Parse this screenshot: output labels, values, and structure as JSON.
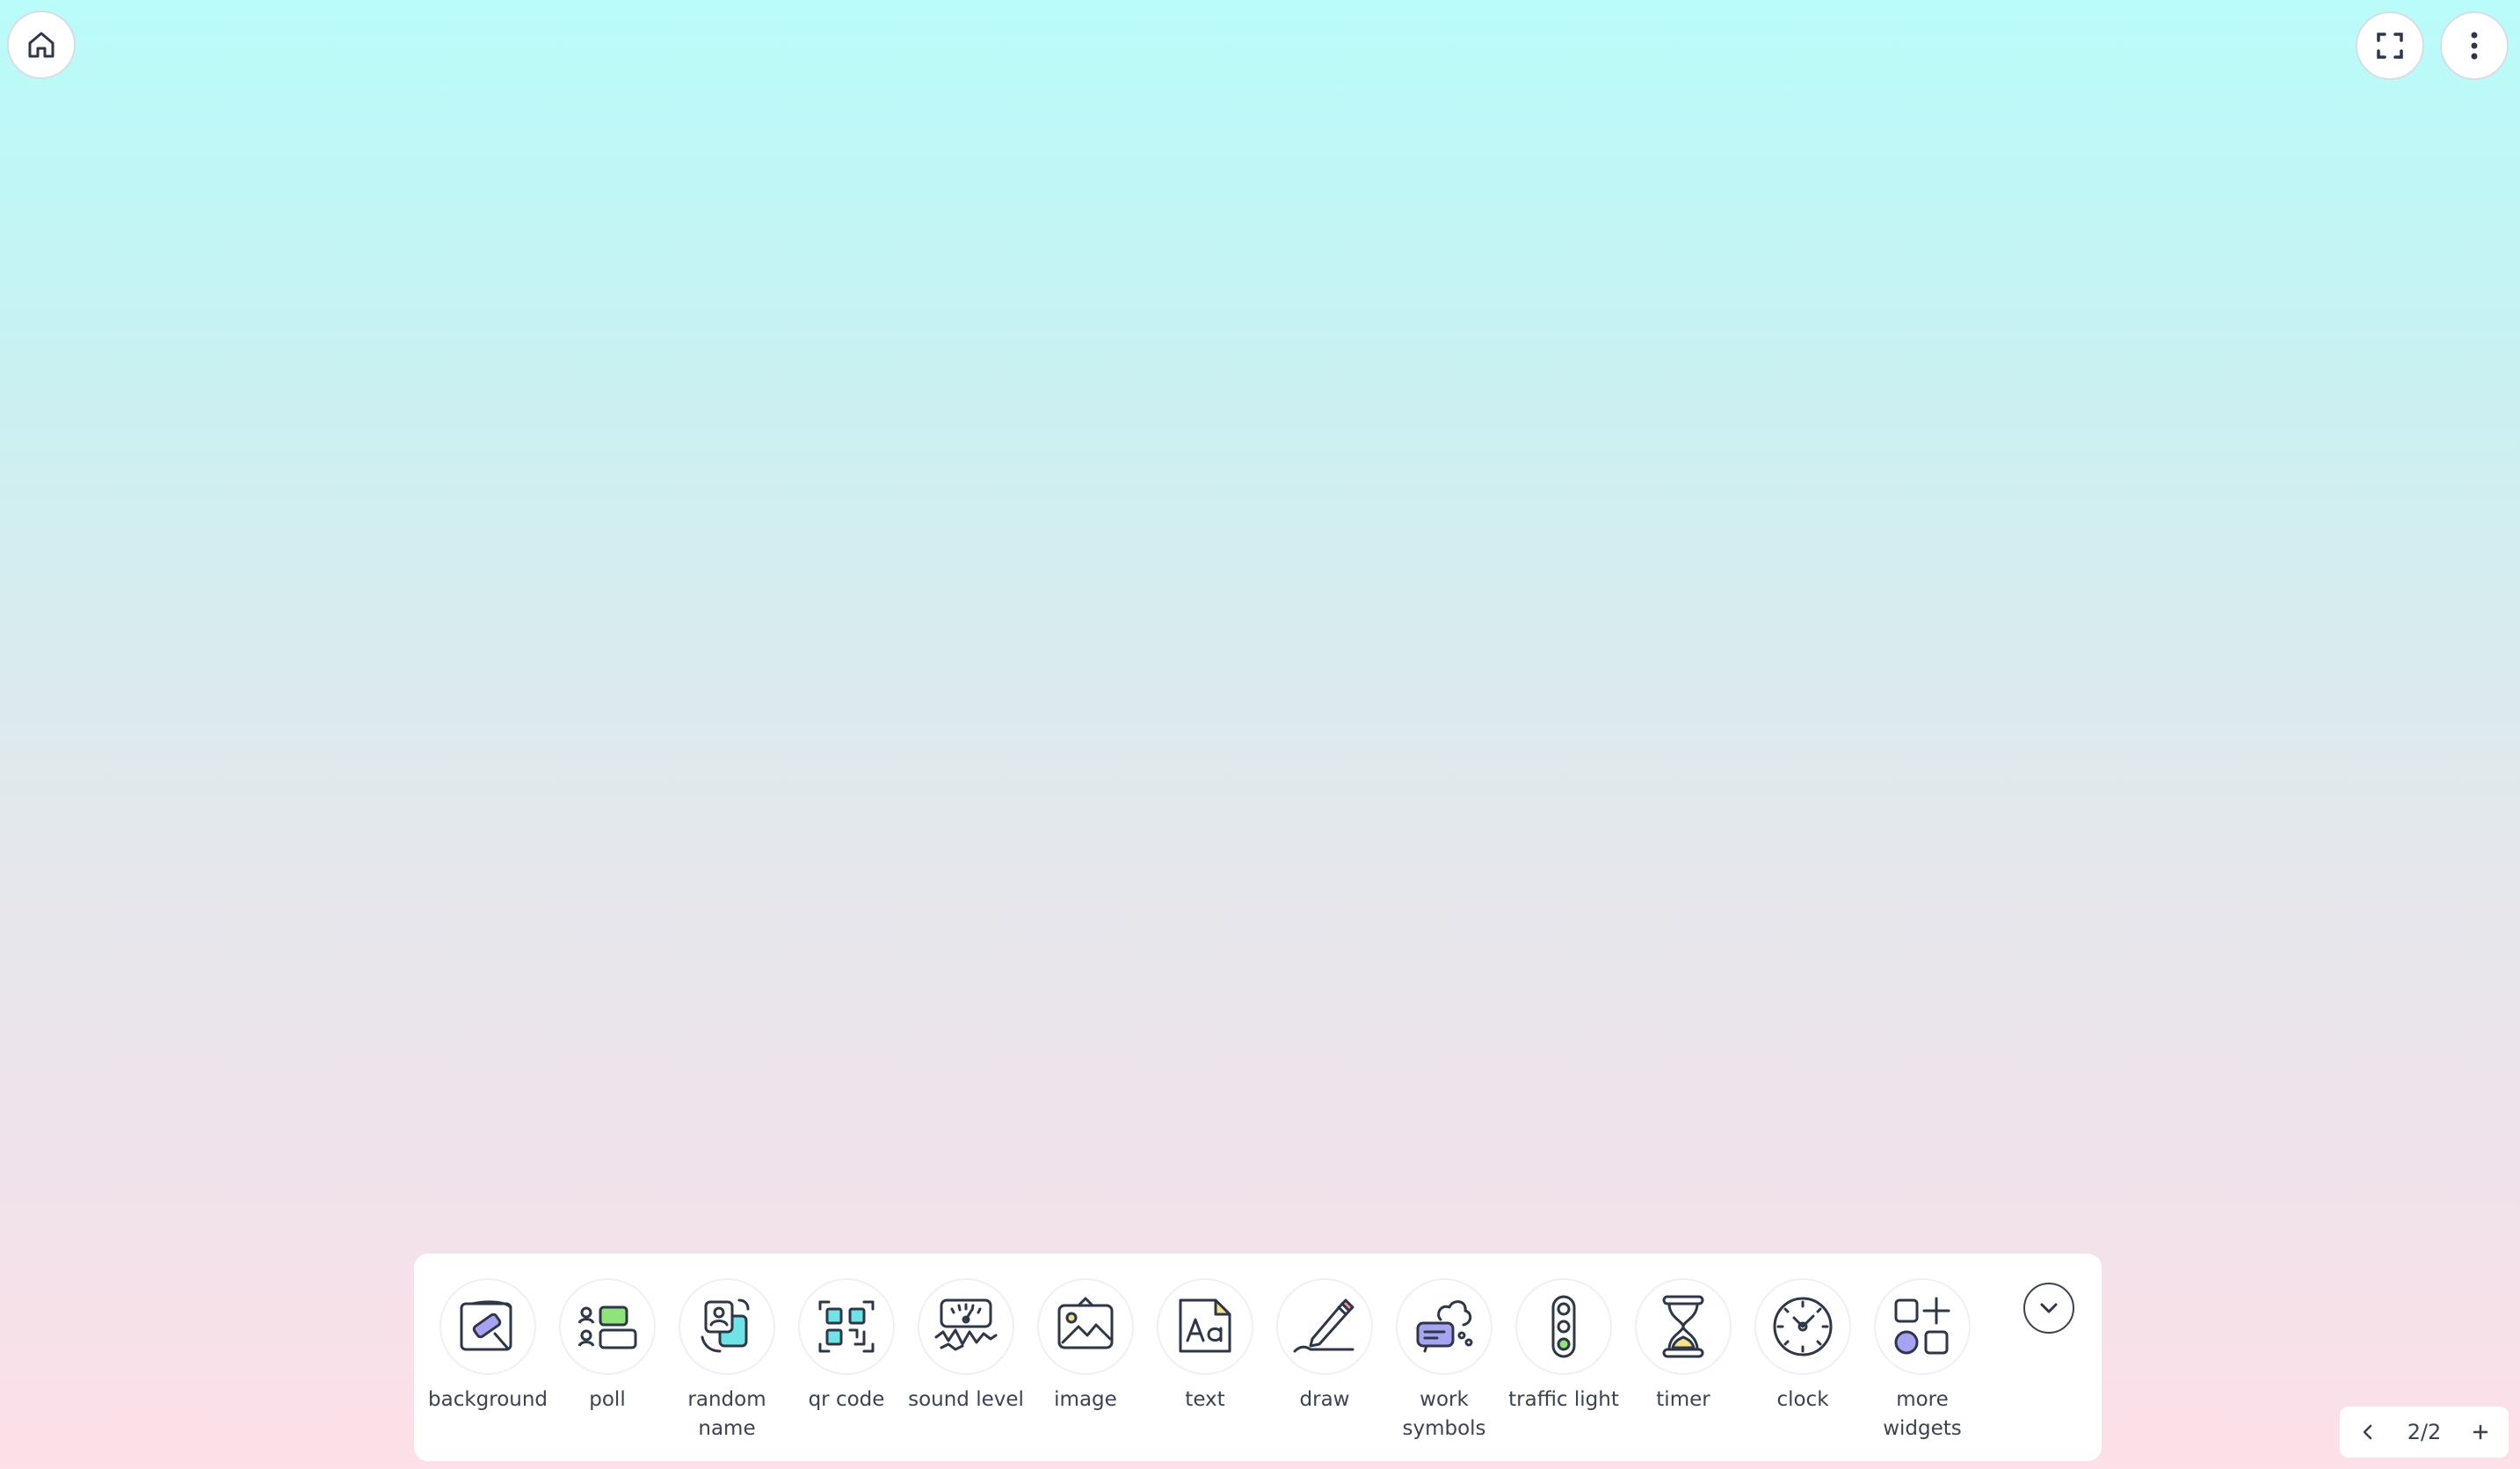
{
  "top_controls": {
    "home_icon": "home-icon",
    "fullscreen_icon": "fullscreen-icon",
    "menu_icon": "vertical-dots-icon"
  },
  "toolbar": {
    "tools": [
      {
        "label": "background",
        "icon": "paint-roller-icon"
      },
      {
        "label": "poll",
        "icon": "poll-icon"
      },
      {
        "label": "random name",
        "icon": "random-name-icon"
      },
      {
        "label": "qr code",
        "icon": "qr-code-icon"
      },
      {
        "label": "sound level",
        "icon": "sound-level-icon"
      },
      {
        "label": "image",
        "icon": "image-icon"
      },
      {
        "label": "text",
        "icon": "text-icon"
      },
      {
        "label": "draw",
        "icon": "pencil-icon"
      },
      {
        "label": "work symbols",
        "icon": "work-symbols-icon"
      },
      {
        "label": "traffic light",
        "icon": "traffic-light-icon"
      },
      {
        "label": "timer",
        "icon": "hourglass-icon"
      },
      {
        "label": "clock",
        "icon": "clock-icon"
      },
      {
        "label": "more widgets",
        "icon": "more-widgets-icon"
      }
    ],
    "collapse_icon": "chevron-down-icon"
  },
  "pager": {
    "page_indicator": "2/2",
    "prev_icon": "chevron-left-icon",
    "add_icon": "plus-icon"
  },
  "colors": {
    "accent_purple": "#a7a3f2",
    "accent_green": "#8fe37a",
    "accent_cyan": "#6fe3e6",
    "accent_yellow": "#f7e08a",
    "outline": "#2d3748"
  }
}
